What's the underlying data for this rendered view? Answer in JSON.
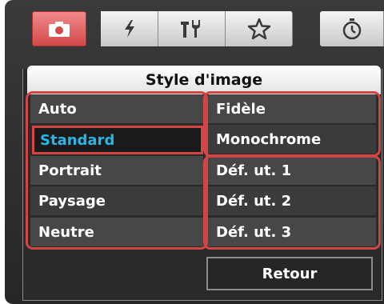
{
  "tabs": [
    {
      "icon": "camera-icon",
      "active": true
    },
    {
      "icon": "flash-icon",
      "active": false
    },
    {
      "icon": "tools-icon",
      "active": false
    },
    {
      "icon": "star-icon",
      "active": false
    },
    {
      "icon": "timer-icon",
      "active": false
    }
  ],
  "panel": {
    "title": "Style d'image",
    "left_column": [
      "Auto",
      "Standard",
      "Portrait",
      "Paysage",
      "Neutre"
    ],
    "right_column": [
      "Fidèle",
      "Monochrome",
      "Déf. ut. 1",
      "Déf. ut. 2",
      "Déf. ut. 3"
    ],
    "selected": "Standard",
    "back_label": "Retour"
  },
  "colors": {
    "active_tab": "#e06060",
    "selected_text": "#29b6e6",
    "highlight_border": "#d24545",
    "panel_bg": "#2a2a2a"
  }
}
